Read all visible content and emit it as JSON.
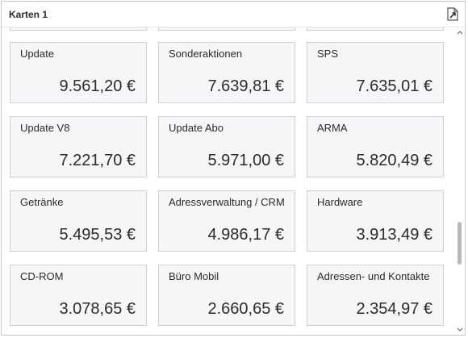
{
  "panel": {
    "title": "Karten 1",
    "export_icon": "export-icon"
  },
  "cards": [
    {
      "label": "",
      "value": ""
    },
    {
      "label": "",
      "value": ""
    },
    {
      "label": "",
      "value": ""
    },
    {
      "label": "Update",
      "value": "9.561,20 €"
    },
    {
      "label": "Sonderaktionen",
      "value": "7.639,81 €"
    },
    {
      "label": "SPS",
      "value": "7.635,01 €"
    },
    {
      "label": "Update V8",
      "value": "7.221,70 €"
    },
    {
      "label": "Update Abo",
      "value": "5.971,00 €"
    },
    {
      "label": "ARMA",
      "value": "5.820,49 €"
    },
    {
      "label": "Getränke",
      "value": "5.495,53 €"
    },
    {
      "label": "Adressverwaltung / CRM",
      "value": "4.986,17 €"
    },
    {
      "label": "Hardware",
      "value": "3.913,49 €"
    },
    {
      "label": "CD-ROM",
      "value": "3.078,65 €"
    },
    {
      "label": "Büro Mobil",
      "value": "2.660,65 €"
    },
    {
      "label": "Adressen- und Kontakte",
      "value": "2.354,97 €"
    }
  ],
  "scrollbar": {
    "position_fraction": 0.75,
    "visible_fraction": 0.15
  }
}
